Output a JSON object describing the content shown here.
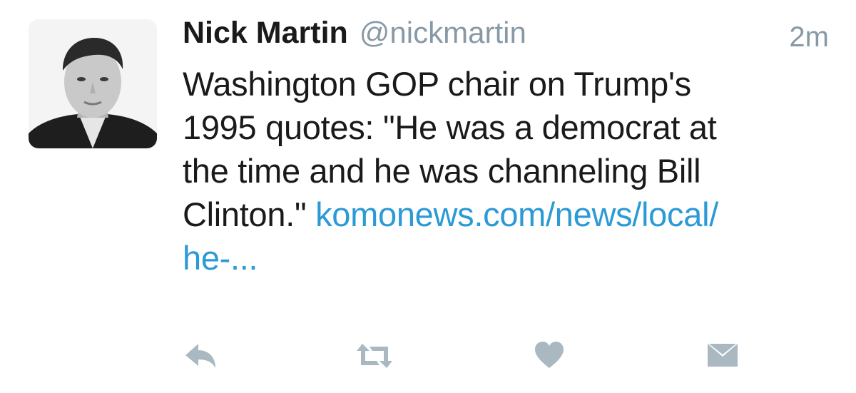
{
  "tweet": {
    "author_name": "Nick Martin",
    "author_handle": "@nickmartin",
    "timestamp": "2m",
    "text_lines": [
      "Washington GOP chair on Trump's",
      "1995 quotes: \"He was a democrat at",
      "the time and he was channeling Bill"
    ],
    "text_line4_prefix": "Clinton.\" ",
    "link_part1": "komonews.com/news/local/",
    "link_part2": "he-..."
  },
  "actions": {
    "reply_icon": "reply-icon",
    "retweet_icon": "retweet-icon",
    "like_icon": "heart-icon",
    "dm_icon": "envelope-icon"
  },
  "colors": {
    "link": "#2b9ad6",
    "muted": "#8899a6",
    "icon": "#aab8c2"
  }
}
